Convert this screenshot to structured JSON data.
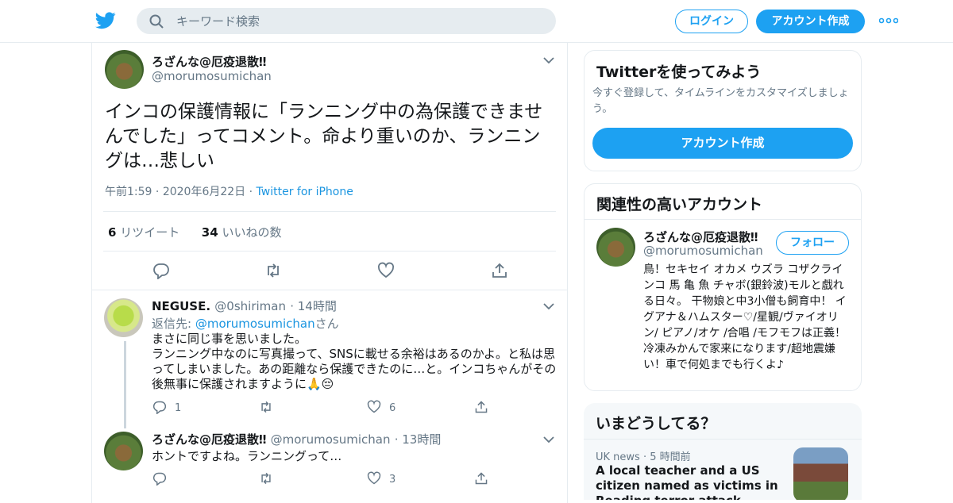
{
  "header": {
    "search_placeholder": "キーワード検索",
    "login_label": "ログイン",
    "signup_label": "アカウント作成"
  },
  "tweet": {
    "author_name": "ろざんな@厄疫退散‼︎",
    "author_handle": "@morumosumichan",
    "text": "インコの保護情報に「ランニング中の為保護できませんでした」ってコメント。命より重いのか、ランニングは…悲しい",
    "time": "午前1:59",
    "date": "2020年6月22日",
    "source": "Twitter for iPhone",
    "retweet_count": "6",
    "retweet_label": "リツイート",
    "like_count": "34",
    "like_label": "いいねの数"
  },
  "replies": [
    {
      "name": "NEGUSE.",
      "handle": "@0shiriman",
      "time": "14時間",
      "reply_to_prefix": "返信先: ",
      "reply_to_handle": "@morumosumichan",
      "reply_to_suffix": "さん",
      "text": "まさに同じ事を思いました。\nランニング中なのに写真撮って、SNSに載せる余裕はあるのかよ。と私は思ってしまいました。あの距離なら保護できたのに…と。インコちゃんがその後無事に保護されますように🙏😔",
      "reply_count": "1",
      "retweet_count": "",
      "like_count": "6"
    },
    {
      "name": "ろざんな@厄疫退散‼︎",
      "handle": "@morumosumichan",
      "time": "13時間",
      "text": "ホントですよね。ランニングって…",
      "reply_count": "",
      "retweet_count": "",
      "like_count": "3"
    }
  ],
  "sidebar": {
    "try_title": "Twitterを使ってみよう",
    "try_desc": "今すぐ登録して、タイムラインをカスタマイズしましょう。",
    "try_button": "アカウント作成",
    "related_title": "関連性の高いアカウント",
    "related_name": "ろざんな@厄疫退散‼︎",
    "related_handle": "@morumosumichan",
    "follow_label": "フォロー",
    "related_bio": "鳥！セキセイ オカメ ウズラ コザクラインコ 馬 亀 魚 チャボ(銀鈴波)モルと戯れる日々。 干物娘と中3小僧も飼育中！ イグアナ＆ハムスター♡/星観/ヴァイオリン/ ピアノ/オケ /合唱 /モフモフは正義！冷凍みかんで家来になります/超地震嫌い！車で何処までも行くよ♪",
    "trends_title": "いまどうしてる？",
    "trend_meta": "UK news · 5 時間前",
    "trend_text": "A local teacher and a US citizen named as victims in Reading terror attack"
  },
  "colors": {
    "brand": "#1da1f2",
    "link": "#1b95e0",
    "secondary_text": "#657786",
    "border": "#e6ecf0"
  }
}
